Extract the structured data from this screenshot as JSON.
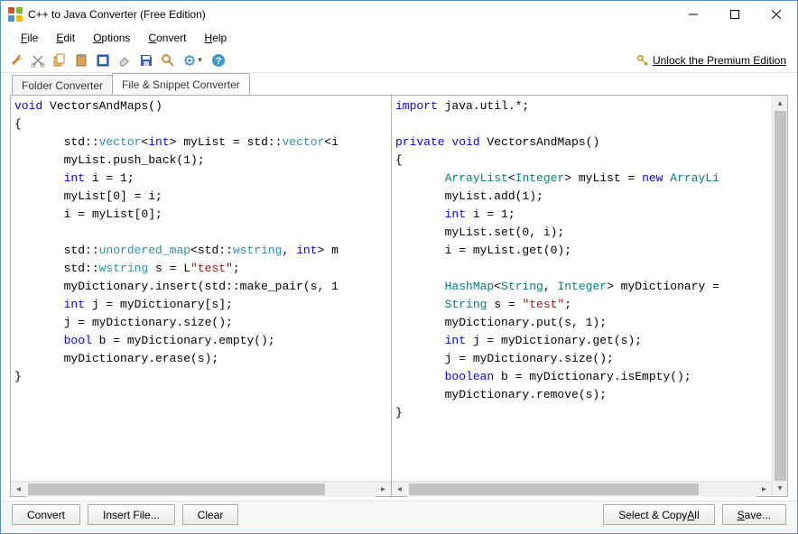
{
  "window": {
    "title": "C++ to Java Converter (Free Edition)"
  },
  "menu": {
    "file": "File",
    "edit": "Edit",
    "options": "Options",
    "convert": "Convert",
    "help": "Help"
  },
  "toolbar": {
    "unlock": "Unlock the Premium Edition"
  },
  "tabs": {
    "folder": "Folder Converter",
    "file": "File & Snippet Converter"
  },
  "buttons": {
    "convert": "Convert",
    "insert_file": "Insert File...",
    "clear": "Clear",
    "select_copy": "Select & Copy All",
    "save": "Save..."
  },
  "code": {
    "cpp": [
      {
        "t": "kw",
        "s": "void"
      },
      {
        "t": "",
        "s": " VectorsAndMaps()\n{\n       std::"
      },
      {
        "t": "ty",
        "s": "vector"
      },
      {
        "t": "",
        "s": "<"
      },
      {
        "t": "kw",
        "s": "int"
      },
      {
        "t": "",
        "s": "> myList = std::"
      },
      {
        "t": "ty",
        "s": "vector"
      },
      {
        "t": "",
        "s": "<i\n       myList.push_back(1);\n       "
      },
      {
        "t": "kw",
        "s": "int"
      },
      {
        "t": "",
        "s": " i = 1;\n       myList[0] = i;\n       i = myList[0];\n\n       std::"
      },
      {
        "t": "ty",
        "s": "unordered_map"
      },
      {
        "t": "",
        "s": "<std::"
      },
      {
        "t": "ty",
        "s": "wstring"
      },
      {
        "t": "",
        "s": ", "
      },
      {
        "t": "kw",
        "s": "int"
      },
      {
        "t": "",
        "s": "> m\n       std::"
      },
      {
        "t": "ty",
        "s": "wstring"
      },
      {
        "t": "",
        "s": " s = L"
      },
      {
        "t": "str",
        "s": "\"test\""
      },
      {
        "t": "",
        "s": ";\n       myDictionary.insert(std::make_pair(s, 1\n       "
      },
      {
        "t": "kw",
        "s": "int"
      },
      {
        "t": "",
        "s": " j = myDictionary[s];\n       j = myDictionary.size();\n       "
      },
      {
        "t": "kw",
        "s": "bool"
      },
      {
        "t": "",
        "s": " b = myDictionary.empty();\n       myDictionary.erase(s);\n}\n"
      }
    ],
    "java": [
      {
        "t": "kw",
        "s": "import"
      },
      {
        "t": "",
        "s": " java.util.*;\n\n"
      },
      {
        "t": "kw",
        "s": "private void"
      },
      {
        "t": "",
        "s": " VectorsAndMaps()\n{\n       "
      },
      {
        "t": "tyj",
        "s": "ArrayList"
      },
      {
        "t": "",
        "s": "<"
      },
      {
        "t": "tyj",
        "s": "Integer"
      },
      {
        "t": "",
        "s": "> myList = "
      },
      {
        "t": "kw",
        "s": "new"
      },
      {
        "t": "",
        "s": " "
      },
      {
        "t": "tyj",
        "s": "ArrayLi"
      },
      {
        "t": "",
        "s": "\n       myList.add(1);\n       "
      },
      {
        "t": "kw",
        "s": "int"
      },
      {
        "t": "",
        "s": " i = 1;\n       myList.set(0, i);\n       i = myList.get(0);\n\n       "
      },
      {
        "t": "tyj",
        "s": "HashMap"
      },
      {
        "t": "",
        "s": "<"
      },
      {
        "t": "tyj",
        "s": "String"
      },
      {
        "t": "",
        "s": ", "
      },
      {
        "t": "tyj",
        "s": "Integer"
      },
      {
        "t": "",
        "s": "> myDictionary =\n       "
      },
      {
        "t": "tyj",
        "s": "String"
      },
      {
        "t": "",
        "s": " s = "
      },
      {
        "t": "str",
        "s": "\"test\""
      },
      {
        "t": "",
        "s": ";\n       myDictionary.put(s, 1);\n       "
      },
      {
        "t": "kw",
        "s": "int"
      },
      {
        "t": "",
        "s": " j = myDictionary.get(s);\n       j = myDictionary.size();\n       "
      },
      {
        "t": "kw",
        "s": "boolean"
      },
      {
        "t": "",
        "s": " b = myDictionary.isEmpty();\n       myDictionary.remove(s);\n}\n"
      }
    ]
  }
}
